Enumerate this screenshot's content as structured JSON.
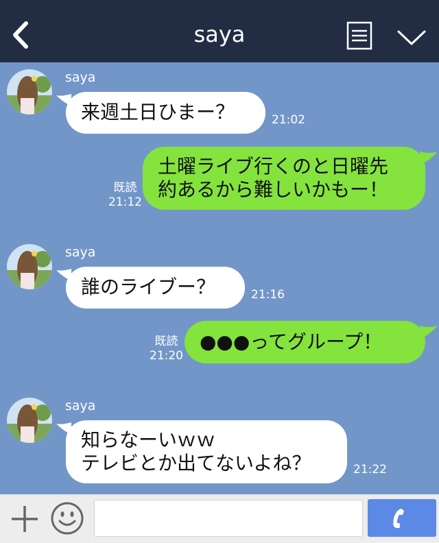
{
  "header": {
    "title": "saya",
    "background": "#222d44",
    "back_icon": "chevron-left-icon",
    "note_icon": "note-icon",
    "menu_icon": "chevron-down-icon"
  },
  "chat": {
    "background": "#7396c8",
    "messages": [
      {
        "sender": "saya",
        "text": "来週土日ひまー？",
        "time": "21:02"
      },
      {
        "text": "土曜ライブ行くのと日曜先\n約あるから難しいかもー！",
        "read": "既読",
        "time": "21:12"
      },
      {
        "sender": "saya",
        "text": "誰のライブー？",
        "time": "21:16"
      },
      {
        "text": "●●●ってグループ！",
        "read": "既読",
        "time": "21:20"
      },
      {
        "sender": "saya",
        "text": "知らなーいｗｗ\nテレビとか出てないよね？",
        "time": "21:22"
      }
    ]
  },
  "input_bar": {
    "plus_icon": "plus-icon",
    "emoji_icon": "smiley-icon",
    "input_value": "",
    "call_icon": "phone-icon",
    "call_button_color": "#5c89e6"
  }
}
